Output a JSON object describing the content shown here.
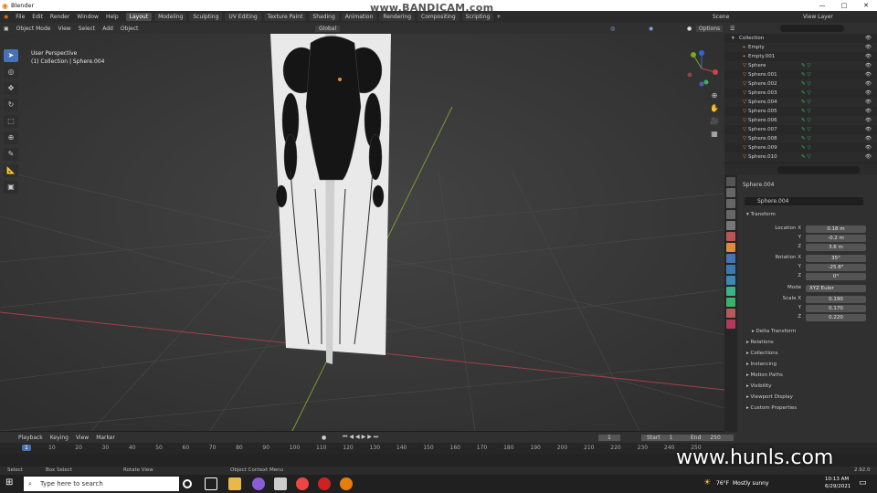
{
  "titlebar": {
    "title": "Blender",
    "watermark": "www.BANDICAM.com",
    "buttons": [
      "—",
      "□",
      "✕"
    ]
  },
  "menu": {
    "items": [
      "File",
      "Edit",
      "Render",
      "Window",
      "Help"
    ],
    "workspaces": [
      "Layout",
      "Modeling",
      "Sculpting",
      "UV Editing",
      "Texture Paint",
      "Shading",
      "Animation",
      "Rendering",
      "Compositing",
      "Scripting"
    ],
    "active_workspace": "Layout",
    "scene": "Scene",
    "view_layer": "View Layer"
  },
  "viewport_header": {
    "mode": "Object Mode",
    "items": [
      "View",
      "Select",
      "Add",
      "Object"
    ],
    "orientation": "Global",
    "options": "Options"
  },
  "viewport": {
    "perspective": "User Perspective",
    "collection_info": "(1) Collection | Sphere.004"
  },
  "outliner": {
    "root": "Collection",
    "items": [
      "Empty",
      "Empty.001",
      "Sphere",
      "Sphere.001",
      "Sphere.002",
      "Sphere.003",
      "Sphere.004",
      "Sphere.005",
      "Sphere.006",
      "Sphere.007",
      "Sphere.008",
      "Sphere.009",
      "Sphere.010"
    ]
  },
  "properties": {
    "object_name": "Sphere.004",
    "data_name": "Sphere.004",
    "transform_label": "Transform",
    "location": {
      "label": "Location X",
      "x": "0.18 m",
      "y": "-0.2 m",
      "z": "3.6 m"
    },
    "rotation": {
      "label": "Rotation X",
      "x": "35°",
      "y": "-25.8°",
      "z": "0°"
    },
    "mode_label": "Mode",
    "mode": "XYZ Euler",
    "scale": {
      "label": "Scale X",
      "x": "0.190",
      "y": "0.170",
      "z": "0.220"
    },
    "axis_y": "Y",
    "axis_z": "Z",
    "sections": [
      "Delta Transform",
      "Relations",
      "Collections",
      "Instancing",
      "Motion Paths",
      "Visibility",
      "Viewport Display",
      "Custom Properties"
    ]
  },
  "timeline": {
    "items": [
      "Playback",
      "Keying",
      "View",
      "Marker"
    ],
    "current_frame": "1",
    "start_label": "Start",
    "start": "1",
    "end_label": "End",
    "end": "250",
    "ruler": [
      "10",
      "20",
      "30",
      "40",
      "50",
      "60",
      "70",
      "80",
      "90",
      "100",
      "110",
      "120",
      "130",
      "140",
      "150",
      "160",
      "170",
      "180",
      "190",
      "200",
      "210",
      "220",
      "230",
      "240",
      "250"
    ],
    "ruler_start": "1"
  },
  "statusbar": {
    "select": "Select",
    "box_select": "Box Select",
    "rotate_view": "Rotate View",
    "context_menu": "Object Context Menu",
    "version": "2.92.0"
  },
  "taskbar": {
    "search_placeholder": "Type here to search",
    "weather_temp": "76°F",
    "weather_text": "Mostly sunny",
    "time": "10:13 AM",
    "date": "6/29/2021"
  },
  "overlay_watermark": "www.hunls.com",
  "colors": {
    "accent": "#4772b3",
    "header": "#303030",
    "panel": "#282828",
    "orange": "#e08a3c"
  }
}
